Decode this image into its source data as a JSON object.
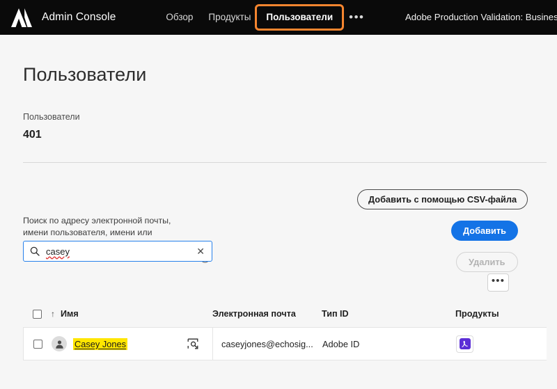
{
  "topbar": {
    "logo_icon": "adobe-logo-icon",
    "app_title": "Admin Console",
    "nav": [
      {
        "label": "Обзор",
        "active": false
      },
      {
        "label": "Продукты",
        "active": false
      },
      {
        "label": "Пользователи",
        "active": true
      }
    ],
    "more_label": "•••",
    "org_name": "Adobe Production Validation: BusinessTr",
    "focus_ring_color": "#f5852f"
  },
  "page": {
    "title": "Пользователи",
    "stat": {
      "label": "Пользователи",
      "value": "401"
    }
  },
  "actions": {
    "csv_label": "Добавить с помощью CSV-файла",
    "add_label": "Добавить",
    "delete_label": "Удалить",
    "more_label": "•••",
    "add_color": "#1473e6"
  },
  "search": {
    "label": "Поиск по адресу электронной почты, имени пользователя, имени или фамилии",
    "info_icon": "info-icon",
    "search_icon": "search-icon",
    "value": "casey",
    "clear_label": "✕",
    "focus_border_color": "#2680eb"
  },
  "table": {
    "columns": [
      {
        "key": "check",
        "label": ""
      },
      {
        "key": "name",
        "label": "Имя",
        "sort": "↑"
      },
      {
        "key": "email",
        "label": "Электронная почта"
      },
      {
        "key": "idtype",
        "label": "Тип ID"
      },
      {
        "key": "products",
        "label": "Продукты"
      }
    ],
    "rows": [
      {
        "name": "Casey Jones",
        "email": "caseyjones@echosig...",
        "idtype": "Adobe ID",
        "product_icon": "acrobat-icon",
        "product_color": "#5c2ed6",
        "highlight_color": "#ffe600"
      }
    ]
  }
}
